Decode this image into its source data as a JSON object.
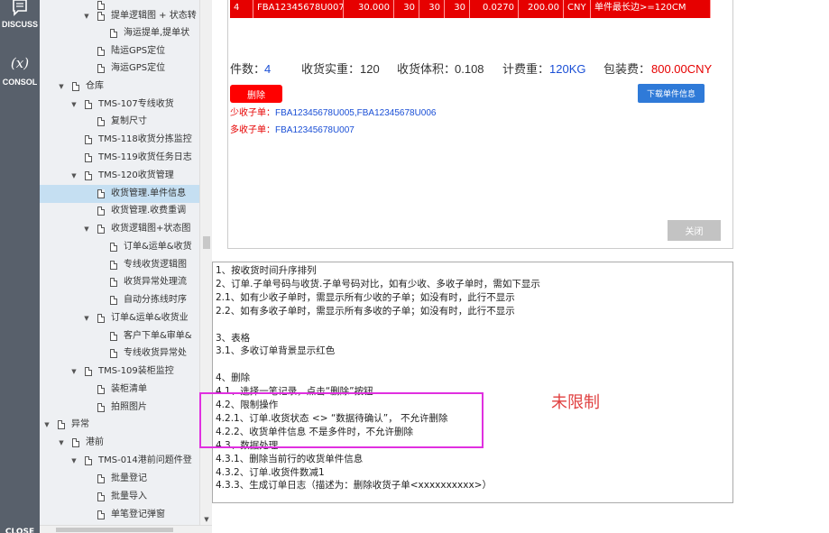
{
  "rail": {
    "items": [
      {
        "label": "DISCUSS",
        "icon": "comment-icon"
      },
      {
        "label": "CONSOL",
        "icon": "fx-icon",
        "glyph": "(x)"
      }
    ],
    "bottom_label": "CLOSE"
  },
  "tree": {
    "rows": [
      {
        "text": "",
        "level": 4,
        "type": "doc"
      },
      {
        "text": "提单逻辑图 + 状态转",
        "level": 4,
        "type": "folder"
      },
      {
        "text": "海运提单,提单状",
        "level": 5,
        "type": "doc"
      },
      {
        "text": "陆运GPS定位",
        "level": 4,
        "type": "doc"
      },
      {
        "text": "海运GPS定位",
        "level": 4,
        "type": "doc"
      },
      {
        "text": "仓库",
        "level": 2,
        "type": "folder"
      },
      {
        "text": "TMS-107专线收货",
        "level": 3,
        "type": "folder"
      },
      {
        "text": "复制尺寸",
        "level": 4,
        "type": "doc"
      },
      {
        "text": "TMS-118收货分拣监控",
        "level": 3,
        "type": "doc"
      },
      {
        "text": "TMS-119收货任务日志",
        "level": 3,
        "type": "doc"
      },
      {
        "text": "TMS-120收货管理",
        "level": 3,
        "type": "folder"
      },
      {
        "text": "收货管理.单件信息",
        "level": 4,
        "type": "doc",
        "selected": true
      },
      {
        "text": "收货管理.收费重调",
        "level": 4,
        "type": "doc"
      },
      {
        "text": "收货逻辑图+状态图",
        "level": 4,
        "type": "folder"
      },
      {
        "text": "订单&运单&收货",
        "level": 5,
        "type": "doc"
      },
      {
        "text": "专线收货逻辑图",
        "level": 5,
        "type": "doc"
      },
      {
        "text": "收货异常处理流",
        "level": 5,
        "type": "doc"
      },
      {
        "text": "自动分拣线时序",
        "level": 5,
        "type": "doc"
      },
      {
        "text": "订单&运单&收货业",
        "level": 4,
        "type": "folder"
      },
      {
        "text": "客户下单&审单&",
        "level": 5,
        "type": "doc"
      },
      {
        "text": "专线收货异常处",
        "level": 5,
        "type": "doc"
      },
      {
        "text": "TMS-109装柜监控",
        "level": 3,
        "type": "folder"
      },
      {
        "text": "装柜清单",
        "level": 4,
        "type": "doc"
      },
      {
        "text": "拍照图片",
        "level": 4,
        "type": "doc"
      },
      {
        "text": "异常",
        "level": 1,
        "type": "folder"
      },
      {
        "text": "港前",
        "level": 2,
        "type": "folder"
      },
      {
        "text": "TMS-014港前问题件登",
        "level": 3,
        "type": "folder"
      },
      {
        "text": "批量登记",
        "level": 4,
        "type": "doc"
      },
      {
        "text": "批量导入",
        "level": 4,
        "type": "doc"
      },
      {
        "text": "单笔登记弹窗",
        "level": 4,
        "type": "doc"
      }
    ]
  },
  "strip": {
    "cells": [
      "4",
      "FBA12345678U007",
      "30.000",
      "30",
      "30",
      "30",
      "0.0270",
      "200.00",
      "CNY",
      "单件最长边>=120CM"
    ]
  },
  "summary": {
    "count_label": "件数：",
    "count_value": "4",
    "weight_label": "收货实重：",
    "weight_value": "120",
    "volume_label": "收货体积：",
    "volume_value": "0.108",
    "charge_label": "计费重：",
    "charge_value": "120KG",
    "pack_label": "包装费：",
    "pack_value": "800.00CNY"
  },
  "buttons": {
    "delete": "删除",
    "download": "下载单件信息",
    "close": "关闭"
  },
  "missing": {
    "label": "少收子单：",
    "value": "FBA12345678U005,FBA12345678U006"
  },
  "extra": {
    "label": "多收子单：",
    "value": "FBA12345678U007"
  },
  "notes": [
    "1、按收货时间升序排列",
    "2、订单.子单号码与收货.子单号码对比，如有少收、多收子单时，需如下显示",
    "2.1、如有少收子单时，需显示所有少收的子单；如没有时，此行不显示",
    "2.2、如有多收子单时，需显示所有多收的子单；如没有时，此行不显示",
    "",
    "3、表格",
    "3.1、多收订单背景显示红色",
    "",
    "4、删除",
    "4.1、选择一笔记录，点击“删除”按钮",
    "4.2、限制操作",
    "4.2.1、订单.收货状态 <> “数据待确认”， 不允许删除",
    "4.2.2、收货单件信息 不是多件时，不允许删除",
    "4.3、数据处理",
    "4.3.1、删除当前行的收货单件信息",
    "4.3.2、订单.收货件数减1",
    "4.3.3、生成订单日志（描述为：删除收货子单<xxxxxxxxxx>）"
  ],
  "annotation": "未限制",
  "colors": {
    "rail": "#58606b",
    "tree_bg": "#eef0f3",
    "selected_row": "#c5dff2",
    "strip_red": "#e60000",
    "delete_red": "#ff0000",
    "download_blue": "#2f7ad8",
    "value_blue": "#1a4fd6",
    "highlight_magenta": "#e030e0"
  }
}
